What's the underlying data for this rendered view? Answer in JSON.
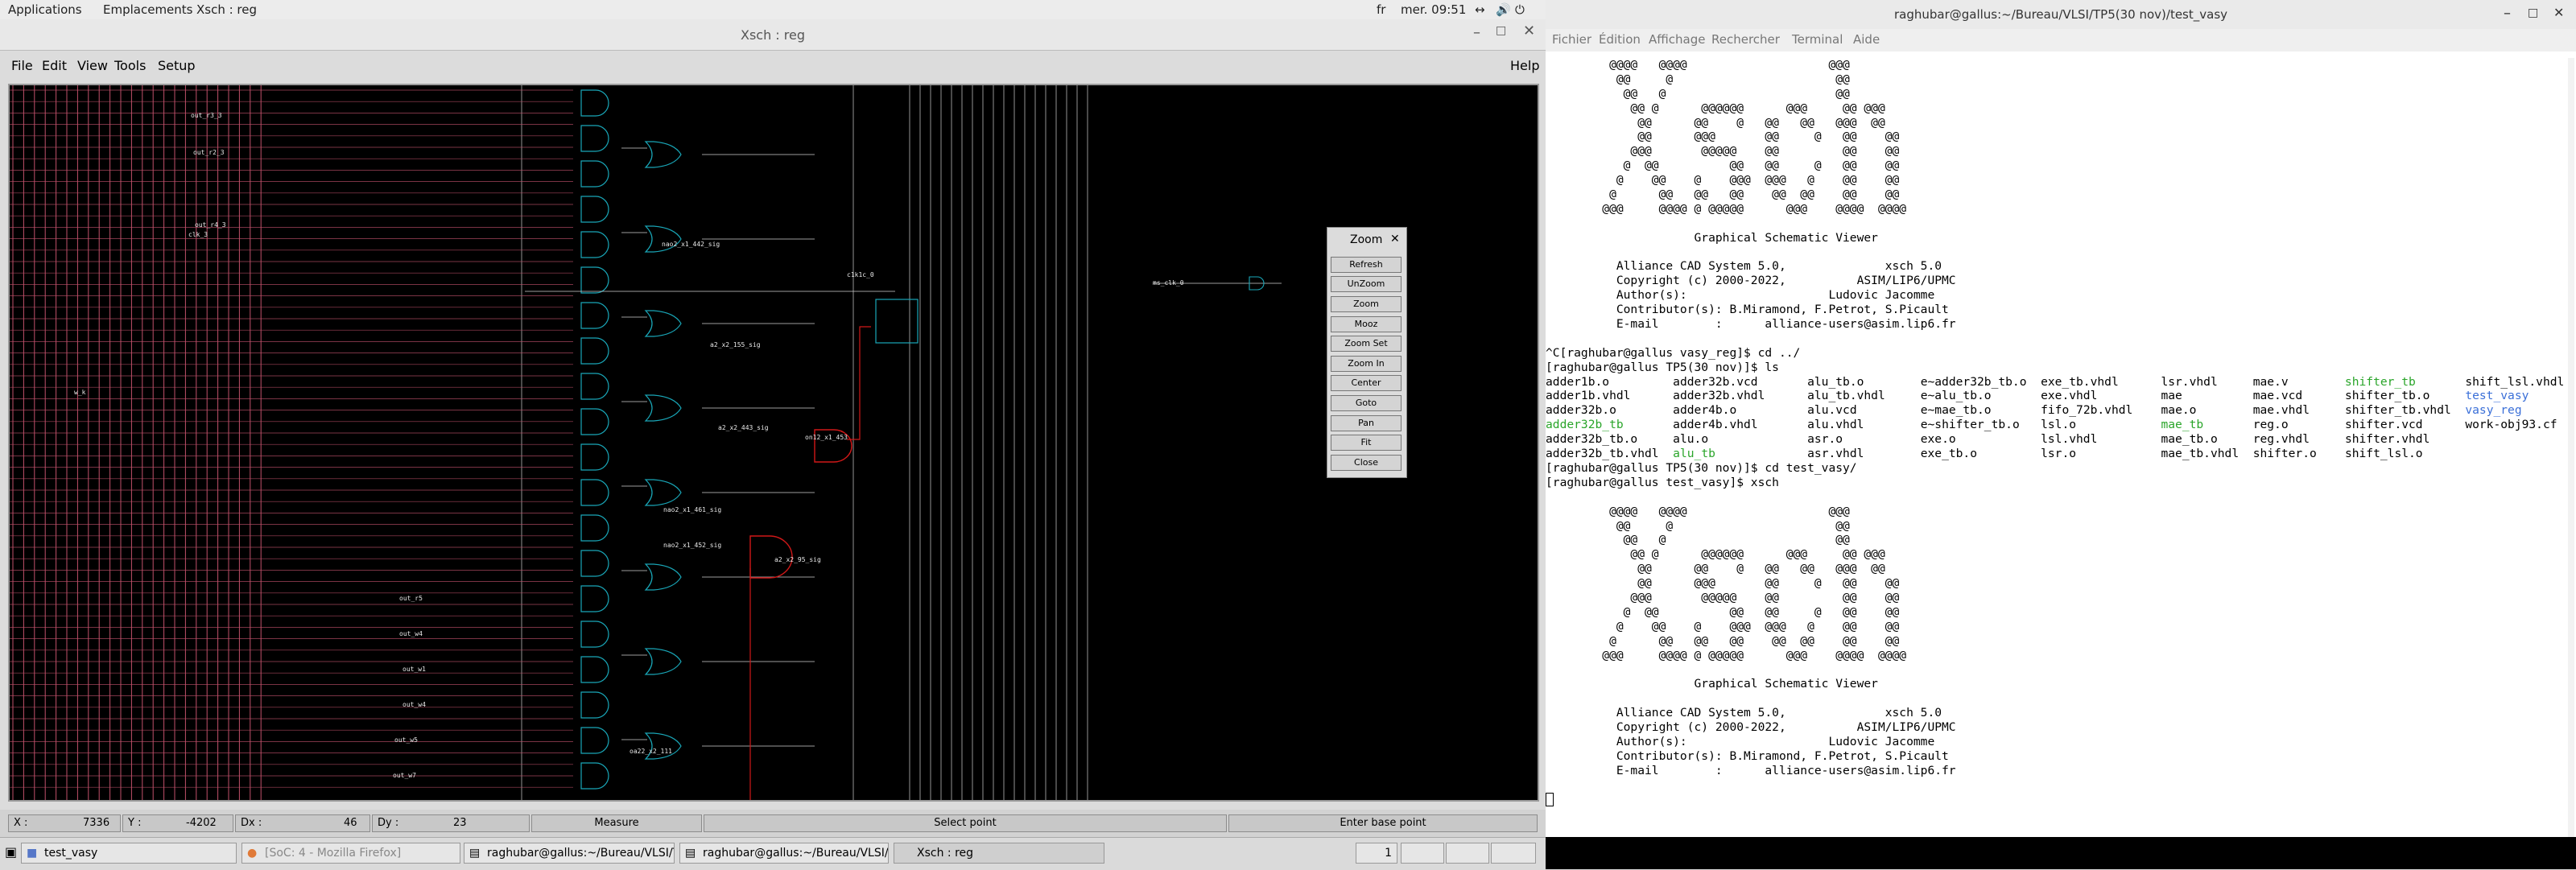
{
  "topbar": {
    "applications": "Applications",
    "places": "Emplacements",
    "active_app": "Xsch : reg",
    "keyboard": "fr",
    "clock": "mer. 09:51"
  },
  "xsch": {
    "title": "Xsch : reg",
    "menu": [
      "File",
      "Edit",
      "View",
      "Tools",
      "Setup"
    ],
    "help": "Help",
    "status": {
      "x_label": "X :",
      "x_value": "7336",
      "y_label": "Y :",
      "y_value": "-4202",
      "dx_label": "Dx :",
      "dx_value": "46",
      "dy_label": "Dy :",
      "dy_value": "23",
      "mode": "Measure",
      "hint1": "Select point",
      "hint2": "Enter base point"
    },
    "zoom": {
      "title": "Zoom",
      "buttons": [
        "Refresh",
        "UnZoom",
        "Zoom",
        "Mooz",
        "Zoom Set",
        "Zoom In",
        "Center",
        "Goto",
        "Pan",
        "Fit",
        "Close"
      ]
    },
    "canvas_labels": [
      "out_r3_3",
      "out_r2_3",
      "out_r4_3",
      "clk_3",
      "out_r5",
      "out_w4",
      "out_w1",
      "out_w4",
      "out_w5",
      "out_w7",
      "w_k",
      "nao2_x1_442_sig",
      "a2_x2_155_sig",
      "a2_x2_443_sig",
      "on12_x1_453",
      "a2_x2_95_sig",
      "nao2_x1_461_sig",
      "nao2_x1_452_sig",
      "c1k1c_0",
      "ms_clk_0",
      "oa22_x2_111"
    ]
  },
  "terminal": {
    "title": "raghubar@gallus:~/Bureau/VLSI/TP5(30 nov)/test_vasy",
    "menu": [
      "Fichier",
      "Édition",
      "Affichage",
      "Rechercher",
      "Terminal",
      "Aide"
    ],
    "art": [
      "         @@@@   @@@@                    @@@",
      "          @@     @                       @@",
      "           @@   @                        @@",
      "            @@ @      @@@@@@      @@@     @@ @@@",
      "             @@      @@    @   @@   @@   @@@  @@",
      "             @@      @@@       @@     @   @@    @@",
      "            @@@       @@@@@    @@         @@    @@",
      "           @  @@          @@   @@     @   @@    @@",
      "          @    @@    @    @@@  @@@   @    @@    @@",
      "         @      @@   @@   @@    @@  @@    @@    @@",
      "        @@@     @@@@ @ @@@@@      @@@    @@@@  @@@@"
    ],
    "banner": [
      "",
      "                     Graphical Schematic Viewer",
      "",
      "          Alliance CAD System 5.0,              xsch 5.0",
      "          Copyright (c) 2000-2022,          ASIM/LIP6/UPMC",
      "          Author(s):                    Ludovic Jacomme",
      "          Contributor(s): B.Miramond, F.Petrot, S.Picault",
      "          E-mail        :      alliance-users@asim.lip6.fr"
    ],
    "cmd1": "^C[raghubar@gallus vasy_reg]$ cd ../",
    "cmd2": "[raghubar@gallus TP5(30 nov)]$ ls",
    "ls_rows": [
      [
        [
          "adder1b.o",
          ""
        ],
        [
          "adder32b.vcd",
          ""
        ],
        [
          "alu_tb.o",
          ""
        ],
        [
          "e~adder32b_tb.o",
          ""
        ],
        [
          "exe_tb.vhdl",
          ""
        ],
        [
          "lsr.vhdl",
          ""
        ],
        [
          "mae.v",
          ""
        ],
        [
          "shifter_tb",
          "green"
        ],
        [
          "shift_lsl.vhdl",
          ""
        ]
      ],
      [
        [
          "adder1b.vhdl",
          ""
        ],
        [
          "adder32b.vhdl",
          ""
        ],
        [
          "alu_tb.vhdl",
          ""
        ],
        [
          "e~alu_tb.o",
          ""
        ],
        [
          "exe.vhdl",
          ""
        ],
        [
          "mae",
          ""
        ],
        [
          "mae.vcd",
          ""
        ],
        [
          "shifter_tb.o",
          ""
        ],
        [
          "test_vasy",
          "blue"
        ]
      ],
      [
        [
          "adder32b.o",
          ""
        ],
        [
          "adder4b.o",
          ""
        ],
        [
          "alu.vcd",
          ""
        ],
        [
          "e~mae_tb.o",
          ""
        ],
        [
          "fifo_72b.vhdl",
          ""
        ],
        [
          "mae.o",
          ""
        ],
        [
          "mae.vhdl",
          ""
        ],
        [
          "shifter_tb.vhdl",
          ""
        ],
        [
          "vasy_reg",
          "blue"
        ]
      ],
      [
        [
          "adder32b_tb",
          "green"
        ],
        [
          "adder4b.vhdl",
          ""
        ],
        [
          "alu.vhdl",
          ""
        ],
        [
          "e~shifter_tb.o",
          ""
        ],
        [
          "lsl.o",
          ""
        ],
        [
          "mae_tb",
          "green"
        ],
        [
          "reg.o",
          ""
        ],
        [
          "shifter.vcd",
          ""
        ],
        [
          "work-obj93.cf",
          ""
        ]
      ],
      [
        [
          "adder32b_tb.o",
          ""
        ],
        [
          "alu.o",
          ""
        ],
        [
          "asr.o",
          ""
        ],
        [
          "exe.o",
          ""
        ],
        [
          "lsl.vhdl",
          ""
        ],
        [
          "mae_tb.o",
          ""
        ],
        [
          "reg.vhdl",
          ""
        ],
        [
          "shifter.vhdl",
          ""
        ],
        [
          "",
          ""
        ]
      ],
      [
        [
          "adder32b_tb.vhdl",
          ""
        ],
        [
          "alu_tb",
          "green"
        ],
        [
          "asr.vhdl",
          ""
        ],
        [
          "exe_tb.o",
          ""
        ],
        [
          "lsr.o",
          ""
        ],
        [
          "mae_tb.vhdl",
          ""
        ],
        [
          "shifter.o",
          ""
        ],
        [
          "shift_lsl.o",
          ""
        ],
        [
          "",
          ""
        ]
      ]
    ],
    "cmd3": "[raghubar@gallus TP5(30 nov)]$ cd test_vasy/",
    "cmd4": "[raghubar@gallus test_vasy]$ xsch"
  },
  "taskbar": {
    "items": [
      "test_vasy",
      "[SoC: 4 - Mozilla Firefox]",
      "raghubar@gallus:~/Bureau/VLSI/TP5...",
      "raghubar@gallus:~/Bureau/VLSI/TP5...",
      "Xsch : reg"
    ],
    "workspace": "1"
  },
  "colors": {
    "wire_red": "#c0506a",
    "gate_cyan": "#19a7b8",
    "path_red": "#d01818",
    "terminal_green": "#2aa52a",
    "terminal_blue": "#3a6fd8"
  }
}
